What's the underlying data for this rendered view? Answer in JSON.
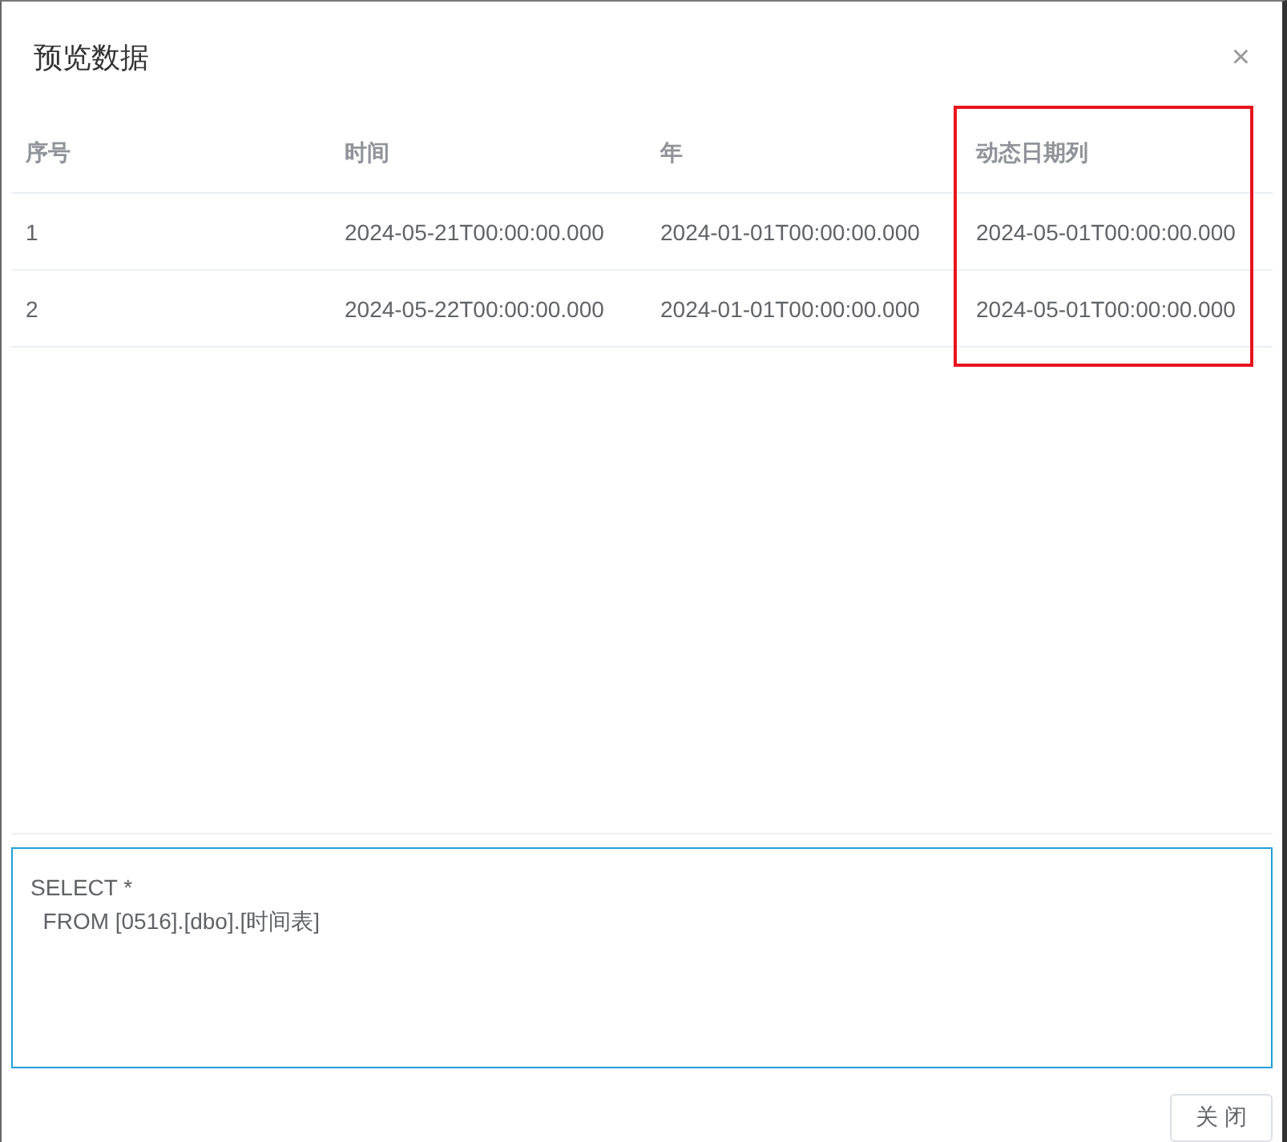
{
  "dialog": {
    "title": "预览数据",
    "close": "×"
  },
  "table": {
    "columns": [
      {
        "label": "序号",
        "highlighted": false
      },
      {
        "label": "时间",
        "highlighted": false
      },
      {
        "label": "年",
        "highlighted": false
      },
      {
        "label": "动态日期列",
        "highlighted": true
      }
    ],
    "rows": [
      [
        "1",
        "2024-05-21T00:00:00.000",
        "2024-01-01T00:00:00.000",
        "2024-05-01T00:00:00.000"
      ],
      [
        "2",
        "2024-05-22T00:00:00.000",
        "2024-01-01T00:00:00.000",
        "2024-05-01T00:00:00.000"
      ]
    ]
  },
  "sql": "SELECT *\n  FROM [0516].[dbo].[时间表]",
  "buttons": [
    "关 闭"
  ]
}
